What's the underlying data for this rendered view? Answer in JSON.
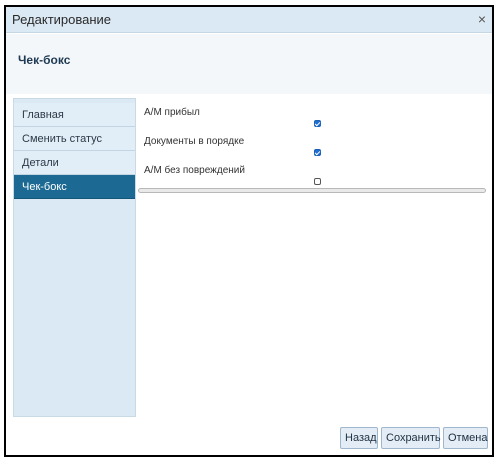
{
  "dialog": {
    "title": "Редактирование",
    "close_symbol": "×"
  },
  "header": {
    "heading": "Чек-бокс"
  },
  "sidebar": {
    "items": [
      {
        "label": "Главная",
        "active": false
      },
      {
        "label": "Сменить статус",
        "active": false
      },
      {
        "label": "Детали",
        "active": false
      },
      {
        "label": "Чек-бокс",
        "active": true
      }
    ]
  },
  "fields": [
    {
      "label": "А/М прибыл",
      "checked": true
    },
    {
      "label": "Документы в порядке",
      "checked": true
    },
    {
      "label": "А/М без повреждений",
      "checked": false
    }
  ],
  "buttons": {
    "back": "Назад",
    "save": "Сохранить",
    "cancel": "Отмена"
  },
  "colors": {
    "accent": "#1c6a93",
    "titlebar": "#dbe9f4",
    "checkbox": "#1f6fd1"
  }
}
